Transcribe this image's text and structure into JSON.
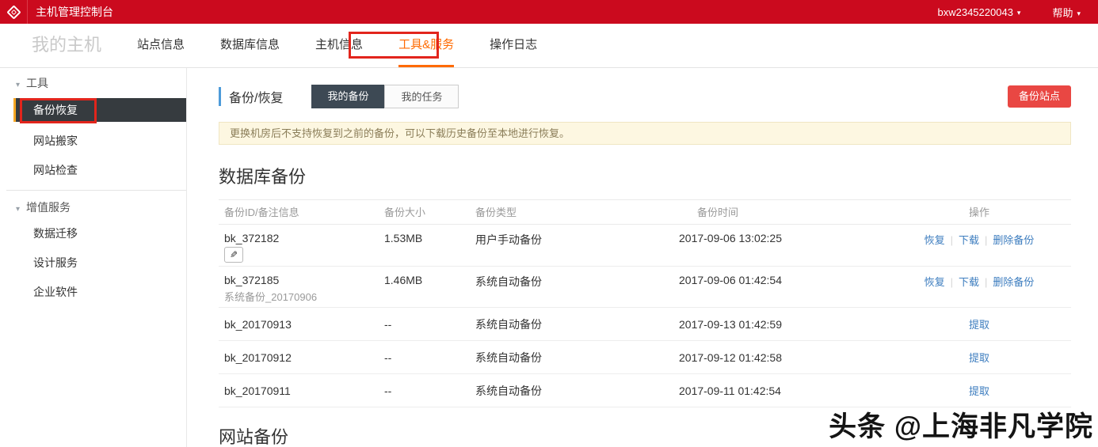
{
  "topbar": {
    "title": "主机管理控制台",
    "username": "bxw2345220043",
    "help_label": "帮助"
  },
  "nav": {
    "home_label": "我的主机",
    "tabs": [
      {
        "label": "站点信息",
        "active": false
      },
      {
        "label": "数据库信息",
        "active": false
      },
      {
        "label": "主机信息",
        "active": false
      },
      {
        "label": "工具&服务",
        "active": true
      },
      {
        "label": "操作日志",
        "active": false
      }
    ]
  },
  "sidebar": {
    "groups": [
      {
        "title": "工具",
        "items": [
          {
            "label": "备份恢复",
            "active": true
          },
          {
            "label": "网站搬家",
            "active": false
          },
          {
            "label": "网站检查",
            "active": false
          }
        ]
      },
      {
        "title": "增值服务",
        "items": [
          {
            "label": "数据迁移",
            "active": false
          },
          {
            "label": "设计服务",
            "active": false
          },
          {
            "label": "企业软件",
            "active": false
          }
        ]
      }
    ]
  },
  "content": {
    "panel_title": "备份/恢复",
    "toggles": [
      {
        "label": "我的备份",
        "active": true
      },
      {
        "label": "我的任务",
        "active": false
      }
    ],
    "backup_site_button": "备份站点",
    "notice": "更换机房后不支持恢复到之前的备份，可以下载历史备份至本地进行恢复。",
    "db_heading": "数据库备份",
    "columns": [
      "备份ID/备注信息",
      "备份大小",
      "备份类型",
      "备份时间",
      "操作"
    ],
    "rows": [
      {
        "id": "bk_372182",
        "note": "",
        "size": "1.53MB",
        "type": "用户手动备份",
        "time": "2017-09-06 13:02:25",
        "action1": "恢复",
        "action2": "下载",
        "action3": "删除备份"
      },
      {
        "id": "bk_372185",
        "note": "系统备份_20170906",
        "size": "1.46MB",
        "type": "系统自动备份",
        "time": "2017-09-06 01:42:54",
        "action1": "恢复",
        "action2": "下载",
        "action3": "删除备份"
      },
      {
        "id": "bk_20170913",
        "size": "--",
        "type": "系统自动备份",
        "time": "2017-09-13 01:42:59",
        "action1": "提取"
      },
      {
        "id": "bk_20170912",
        "size": "--",
        "type": "系统自动备份",
        "time": "2017-09-12 01:42:58",
        "action1": "提取"
      },
      {
        "id": "bk_20170911",
        "size": "--",
        "type": "系统自动备份",
        "time": "2017-09-11 01:42:54",
        "action1": "提取"
      }
    ],
    "site_heading": "网站备份"
  },
  "watermark": "头条 @上海非凡学院",
  "icons": {
    "edit_pencil": "✎",
    "caret_down": "▾",
    "group_triangle": "▾"
  },
  "colors": {
    "brand_red": "#cb0a1e",
    "annotation_red": "#e2251c",
    "active_tab_orange": "#ff6a00",
    "sidebar_active_bg": "#363b3f",
    "sidebar_active_stripe": "#f6a623",
    "link_blue": "#3d7dbf",
    "button_red": "#e94743",
    "panel_accent_blue": "#4d9bd9",
    "notice_bg": "#fdf7e1",
    "notice_text": "#8a7d58"
  }
}
